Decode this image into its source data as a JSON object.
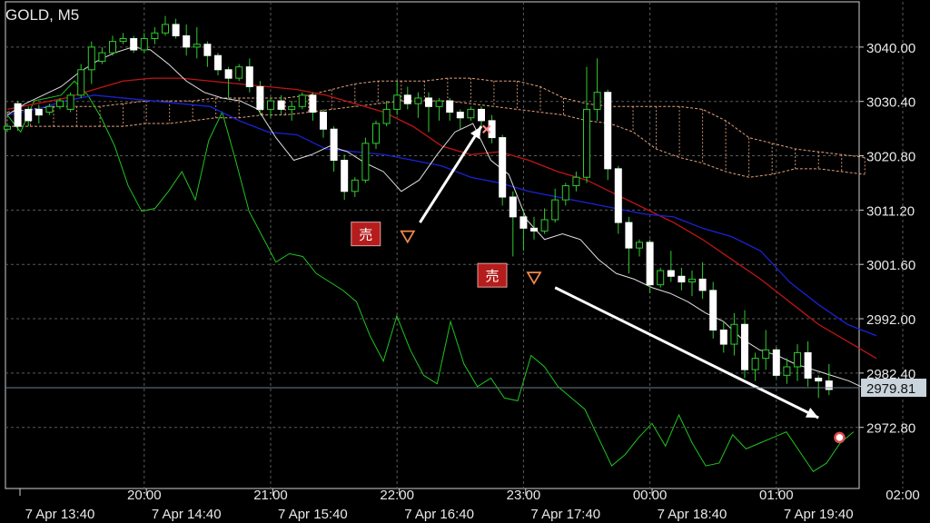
{
  "chart_data": {
    "type": "candlestick",
    "title": "GOLD, M5",
    "price_ticks": [
      "3040.00",
      "3030.40",
      "3020.80",
      "3011.20",
      "3001.60",
      "2992.00",
      "2982.40",
      "2972.80"
    ],
    "price_tick_values": [
      3040.0,
      3030.4,
      3020.8,
      3011.2,
      3001.6,
      2992.0,
      2982.4,
      2972.8
    ],
    "ylim": [
      2962.0,
      3048.0
    ],
    "current_price": {
      "label": "2979.81",
      "value": 2979.81
    },
    "time_top_labels": [
      {
        "label": "20:00",
        "i": 13
      },
      {
        "label": "21:00",
        "i": 25
      },
      {
        "label": "22:00",
        "i": 37
      },
      {
        "label": "23:00",
        "i": 49
      },
      {
        "label": "00:00",
        "i": 61
      },
      {
        "label": "01:00",
        "i": 73
      },
      {
        "label": "02:00",
        "i": 85
      }
    ],
    "time_bottom_labels": [
      {
        "label": "7 Apr 13:40",
        "i": 5
      },
      {
        "label": "7 Apr 14:40",
        "i": 17
      },
      {
        "label": "7 Apr 15:40",
        "i": 29
      },
      {
        "label": "7 Apr 16:40",
        "i": 41
      },
      {
        "label": "7 Apr 17:40",
        "i": 53
      },
      {
        "label": "7 Apr 18:40",
        "i": 65
      },
      {
        "label": "7 Apr 19:40",
        "i": 77
      }
    ],
    "candles": [
      [
        3025.5,
        3026.0,
        3025.0,
        3026.5
      ],
      [
        3030.0,
        3026.0,
        3025.2,
        3030.5
      ],
      [
        3029.0,
        3027.0,
        3026.0,
        3029.5
      ],
      [
        3029.0,
        3028.0,
        3026.5,
        3029.8
      ],
      [
        3028.5,
        3029.5,
        3028.0,
        3030.0
      ],
      [
        3029.5,
        3030.5,
        3029.0,
        3031.0
      ],
      [
        3029.0,
        3031.5,
        3028.5,
        3032.0
      ],
      [
        3031.5,
        3036.0,
        3031.0,
        3037.0
      ],
      [
        3036.0,
        3040.0,
        3033.5,
        3041.0
      ],
      [
        3037.5,
        3039.0,
        3037.0,
        3040.0
      ],
      [
        3039.0,
        3041.0,
        3038.5,
        3042.0
      ],
      [
        3041.0,
        3041.5,
        3040.5,
        3042.5
      ],
      [
        3041.5,
        3039.5,
        3039.0,
        3042.0
      ],
      [
        3039.5,
        3041.5,
        3039.0,
        3042.5
      ],
      [
        3041.5,
        3042.5,
        3040.5,
        3043.5
      ],
      [
        3042.5,
        3044.0,
        3042.0,
        3045.5
      ],
      [
        3044.0,
        3042.0,
        3041.5,
        3045.0
      ],
      [
        3042.0,
        3040.0,
        3038.5,
        3044.0
      ],
      [
        3040.0,
        3040.5,
        3038.0,
        3043.5
      ],
      [
        3040.5,
        3038.5,
        3036.5,
        3041.0
      ],
      [
        3038.5,
        3036.0,
        3035.0,
        3039.0
      ],
      [
        3036.0,
        3034.5,
        3031.0,
        3036.5
      ],
      [
        3034.5,
        3036.5,
        3034.0,
        3037.0
      ],
      [
        3036.5,
        3033.0,
        3032.0,
        3038.0
      ],
      [
        3033.0,
        3029.0,
        3028.0,
        3034.0
      ],
      [
        3029.0,
        3030.5,
        3027.5,
        3031.0
      ],
      [
        3030.5,
        3029.0,
        3028.0,
        3031.5
      ],
      [
        3029.0,
        3029.5,
        3027.0,
        3030.5
      ],
      [
        3029.5,
        3031.5,
        3029.0,
        3032.0
      ],
      [
        3031.5,
        3028.5,
        3027.0,
        3032.0
      ],
      [
        3028.5,
        3025.5,
        3024.0,
        3029.0
      ],
      [
        3025.5,
        3020.0,
        3018.0,
        3026.0
      ],
      [
        3020.0,
        3014.5,
        3013.0,
        3021.0
      ],
      [
        3014.5,
        3016.5,
        3013.5,
        3017.0
      ],
      [
        3016.5,
        3023.0,
        3016.0,
        3024.0
      ],
      [
        3023.0,
        3026.5,
        3022.0,
        3027.0
      ],
      [
        3026.5,
        3029.0,
        3026.0,
        3030.5
      ],
      [
        3029.0,
        3031.5,
        3028.0,
        3034.0
      ],
      [
        3031.5,
        3030.0,
        3029.0,
        3033.0
      ],
      [
        3030.0,
        3031.0,
        3027.5,
        3032.0
      ],
      [
        3031.0,
        3029.5,
        3025.0,
        3032.0
      ],
      [
        3029.5,
        3030.5,
        3027.0,
        3031.0
      ],
      [
        3030.5,
        3028.5,
        3027.0,
        3031.0
      ],
      [
        3028.5,
        3027.5,
        3025.5,
        3029.0
      ],
      [
        3027.5,
        3029.0,
        3027.0,
        3029.5
      ],
      [
        3029.0,
        3027.0,
        3026.0,
        3029.5
      ],
      [
        3027.0,
        3024.0,
        3023.0,
        3028.0
      ],
      [
        3024.0,
        3013.5,
        3012.0,
        3024.5
      ],
      [
        3013.5,
        3010.0,
        3003.0,
        3014.5
      ],
      [
        3010.0,
        3008.0,
        3004.0,
        3011.0
      ],
      [
        3008.0,
        3007.5,
        3006.0,
        3010.0
      ],
      [
        3007.5,
        3009.5,
        3007.0,
        3011.5
      ],
      [
        3009.5,
        3013.0,
        3009.0,
        3015.0
      ],
      [
        3013.0,
        3015.5,
        3012.0,
        3016.0
      ],
      [
        3015.5,
        3017.0,
        3014.5,
        3018.0
      ],
      [
        3017.0,
        3029.0,
        3016.0,
        3036.5
      ],
      [
        3029.0,
        3032.0,
        3027.0,
        3038.0
      ],
      [
        3032.0,
        3018.5,
        3016.5,
        3032.5
      ],
      [
        3018.5,
        3009.0,
        3007.0,
        3019.0
      ],
      [
        3009.0,
        3004.5,
        3000.0,
        3010.0
      ],
      [
        3004.5,
        3005.5,
        3003.0,
        3006.0
      ],
      [
        3005.5,
        2998.0,
        2996.5,
        3006.0
      ],
      [
        2998.0,
        3000.5,
        2997.5,
        3001.0
      ],
      [
        3000.5,
        2999.5,
        2998.5,
        3004.0
      ],
      [
        2999.5,
        2998.5,
        2997.0,
        3001.0
      ],
      [
        2998.5,
        2999.0,
        2996.0,
        3000.5
      ],
      [
        2999.0,
        2997.0,
        2995.5,
        3002.0
      ],
      [
        2997.0,
        2990.0,
        2988.5,
        2998.5
      ],
      [
        2990.0,
        2987.5,
        2986.0,
        2991.5
      ],
      [
        2987.5,
        2991.0,
        2985.5,
        2993.0
      ],
      [
        2991.0,
        2983.0,
        2981.5,
        2993.5
      ],
      [
        2983.0,
        2985.0,
        2981.0,
        2986.0
      ],
      [
        2985.0,
        2986.5,
        2983.0,
        2990.0
      ],
      [
        2986.5,
        2982.0,
        2981.5,
        2987.0
      ],
      [
        2982.0,
        2983.5,
        2980.5,
        2985.0
      ],
      [
        2983.5,
        2986.0,
        2981.0,
        2987.5
      ],
      [
        2986.0,
        2981.5,
        2980.0,
        2988.0
      ],
      [
        2981.5,
        2981.0,
        2978.0,
        2982.0
      ],
      [
        2981.0,
        2979.5,
        2978.5,
        2984.0
      ]
    ],
    "indicators": {
      "tenkan_white": [
        3028.0,
        3030.0,
        3031.5,
        3033.0,
        3035.5,
        3037.5,
        3039.0,
        3040.0,
        3039.5,
        3037.0,
        3034.0,
        3032.0,
        3031.0,
        3030.5,
        3029.0,
        3024.0,
        3020.0,
        3021.0,
        3022.5,
        3021.5,
        3019.5,
        3018.0,
        3014.5,
        3016.5,
        3021.0,
        3025.0,
        3026.5,
        3020.0,
        3017.5,
        3009.5,
        3006.0,
        3007.0,
        3006.0,
        3002.5,
        3000.0,
        2999.0,
        2997.5,
        2996.5,
        2995.0,
        2993.0,
        2991.5,
        2988.5,
        2986.5,
        2985.5,
        2984.0,
        2983.0,
        2982.0,
        2981.0,
        2979.5
      ],
      "kijun_blue": [
        3028.0,
        3029.0,
        3030.5,
        3031.5,
        3031.0,
        3030.5,
        3030.0,
        3029.5,
        3027.0,
        3025.0,
        3024.5,
        3022.0,
        3021.5,
        3021.0,
        3020.0,
        3019.0,
        3017.0,
        3016.0,
        3014.5,
        3013.5,
        3012.5,
        3011.5,
        3010.5,
        3010.0,
        3008.0,
        3006.5,
        3004.0,
        2998.5,
        2994.5,
        2991.0,
        2989.0
      ],
      "sma_red": [
        3029.0,
        3030.0,
        3031.0,
        3032.5,
        3034.0,
        3034.5,
        3034.5,
        3034.0,
        3033.5,
        3033.0,
        3032.5,
        3031.5,
        3030.0,
        3028.5,
        3026.0,
        3022.5,
        3021.0,
        3021.5,
        3020.0,
        3018.0,
        3016.5,
        3014.0,
        3011.5,
        3009.0,
        3006.0,
        3002.5,
        2999.0,
        2995.0,
        2991.0,
        2988.0,
        2985.0
      ],
      "chikou_green": [
        3028.0,
        3025.0,
        3030.5,
        3031.0,
        3031.5,
        3034.0,
        3031.5,
        3027.5,
        3022.5,
        3015.5,
        3011.0,
        3011.5,
        3014.5,
        3018.0,
        3013.0,
        3023.5,
        3028.5,
        3020.0,
        3011.0,
        3006.5,
        3002.0,
        3003.5,
        3003.0,
        3000.0,
        2998.5,
        2997.0,
        2995.0,
        2989.0,
        2984.5,
        2992.5,
        2986.5,
        2982.0,
        2980.5,
        2991.5,
        2984.0,
        2980.0,
        2981.5,
        2978.0,
        2977.5,
        2985.5,
        2983.5,
        2980.0,
        2978.0,
        2976.0,
        2971.0,
        2966.0,
        2968.0,
        2971.0,
        2973.5,
        2969.5,
        2975.0,
        2970.0,
        2966.0,
        2966.5,
        2971.5,
        2969.0,
        2970.0,
        2971.0,
        2972.0,
        2968.5,
        2965.0,
        2966.5,
        2970.0,
        2972.0
      ],
      "kumo_upper": [
        3028.5,
        3029.0,
        3029.5,
        3029.5,
        3029.5,
        3030.0,
        3030.5,
        3030.5,
        3030.5,
        3031.0,
        3031.0,
        3031.0,
        3031.0,
        3031.5,
        3032.5,
        3033.5,
        3034.0,
        3034.0,
        3034.0,
        3034.5,
        3034.5,
        3034.0,
        3034.0,
        3033.0,
        3031.0,
        3030.0,
        3029.5,
        3029.5,
        3029.5,
        3029.5,
        3029.0,
        3027.0,
        3024.0,
        3023.0,
        3022.0,
        3021.5,
        3021.0,
        3020.5
      ],
      "kumo_lower": [
        3026.0,
        3026.0,
        3026.0,
        3026.0,
        3026.0,
        3026.0,
        3026.5,
        3026.5,
        3027.0,
        3027.5,
        3027.5,
        3028.0,
        3028.0,
        3028.5,
        3029.0,
        3029.5,
        3030.0,
        3030.5,
        3030.5,
        3030.5,
        3030.0,
        3029.5,
        3029.0,
        3028.5,
        3028.0,
        3027.0,
        3026.5,
        3025.0,
        3022.0,
        3020.5,
        3019.5,
        3018.0,
        3017.0,
        3017.5,
        3018.5,
        3018.5,
        3018.0,
        3017.5
      ]
    },
    "annotations": [
      {
        "label": "売",
        "type": "sell",
        "i": 38,
        "price": 3006.5
      },
      {
        "label": "売",
        "type": "sell",
        "i": 50,
        "price": 2999.2
      }
    ]
  }
}
